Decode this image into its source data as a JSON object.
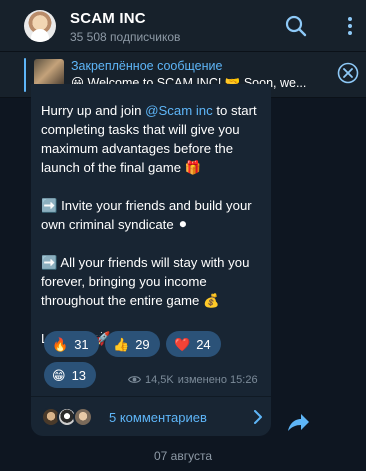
{
  "header": {
    "title": "SCAM INC",
    "subscribers": "35 508 подписчиков"
  },
  "pinned": {
    "title": "Закреплённое сообщение",
    "text": "😀 Welcome to SCAM INC! 🤝 Soon, we..."
  },
  "message": {
    "p1_prefix": "Hurry up and join ",
    "p1_mention": "@Scam inc",
    "p1_suffix": " to start completing tasks that will give you maximum advantages before the launch of the final game 🎁",
    "p2": "➡️ Invite your friends and build your own criminal syndicate ⚫",
    "p3": "➡️ All your friends will stay with you forever, bringing you income throughout the entire game 💰",
    "p4": "Let's go! 🚀"
  },
  "reactions": [
    {
      "emoji": "🔥",
      "count": "31"
    },
    {
      "emoji": "👍",
      "count": "29"
    },
    {
      "emoji": "❤️",
      "count": "24"
    },
    {
      "emoji": "😁",
      "count": "13"
    }
  ],
  "meta": {
    "views": "14,5K",
    "edited_time": "изменено 15:26"
  },
  "comments": {
    "label": "5 комментариев"
  },
  "date_divider": "07 августа",
  "colors": {
    "accent": "#5eb5f7",
    "reaction_bg": "#2b5278",
    "bubble_bg": "#182533",
    "app_bg": "#0e1621",
    "header_bg": "#17212b"
  },
  "icons": [
    "search-icon",
    "more-vertical-icon",
    "close-circle-icon",
    "eye-icon",
    "chevron-right-icon",
    "share-icon"
  ]
}
